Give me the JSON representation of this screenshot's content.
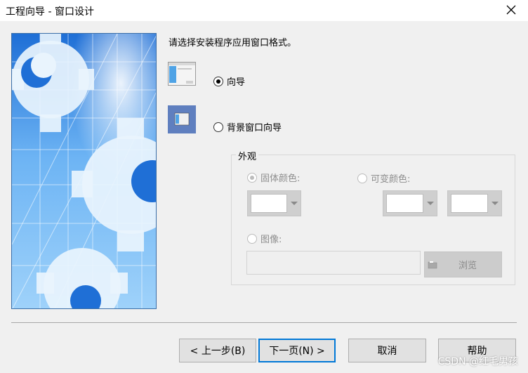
{
  "window": {
    "title": "工程向导 - 窗口设计",
    "close_icon": "close-icon"
  },
  "instruction": "请选择安装程序应用窗口格式。",
  "styles": {
    "wizard_label": "向导",
    "wizard_selected": true,
    "background_label": "背景窗口向导",
    "background_selected": false
  },
  "appearance": {
    "group_label": "外观",
    "solid_color_label": "固体颜色:",
    "variable_color_label": "可变颜色:",
    "image_label": "图像:",
    "image_path": "",
    "browse_label": "浏览"
  },
  "buttons": {
    "back": "< 上一步(B)",
    "next": "下一页(N) >",
    "cancel": "取消",
    "help": "帮助"
  },
  "watermark": "CSDN @红毛男孩",
  "colors": {
    "accent": "#0078d7",
    "banner_sky": "#3f8fe6"
  }
}
